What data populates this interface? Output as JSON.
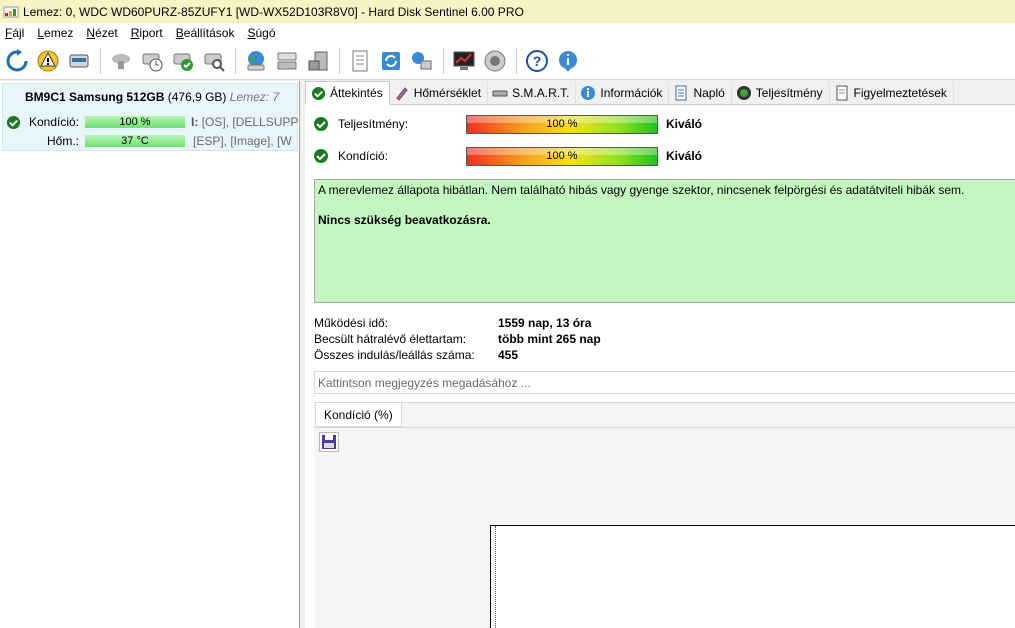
{
  "window": {
    "title": "Lemez: 0, WDC WD60PURZ-85ZUFY1 [WD-WX52D103R8V0]  -  Hard Disk Sentinel 6.00 PRO"
  },
  "menu": [
    {
      "label": "Fájl",
      "u": "F",
      "rest": "ájl"
    },
    {
      "label": "Lemez",
      "u": "L",
      "rest": "emez"
    },
    {
      "label": "Nézet",
      "u": "N",
      "rest": "ézet"
    },
    {
      "label": "Riport",
      "u": "R",
      "rest": "iport"
    },
    {
      "label": "Beállítások",
      "u": "B",
      "rest": "eállítások"
    },
    {
      "label": "Súgó",
      "u": "S",
      "rest": "úgó"
    }
  ],
  "toolbar": {
    "icons": [
      "refresh-icon",
      "alert-icon",
      "disk-icon",
      "disk-cloud-icon",
      "disk-clock-icon",
      "disk-check-icon",
      "disk-search-icon",
      "globe-disk-icon",
      "server-disk-icon",
      "hdd-stack-icon",
      "report-icon",
      "sync-icon",
      "network-icon",
      "monitor-chart-icon",
      "speaker-icon",
      "help-icon",
      "info-icon"
    ]
  },
  "disk": {
    "name": "BM9C1 Samsung 512GB",
    "size": "(476,9 GB)",
    "lemez": "Lemez: 7",
    "kondicio_label": "Kondíció:",
    "kondicio_value": "100 %",
    "hom_label": "Hőm.:",
    "hom_value": "37 °C",
    "parts_line1_letter": "I:",
    "parts_line1": "[OS],  [DELLSUPPORT",
    "parts_line2": "[ESP],  [Image],  [W"
  },
  "tabs": [
    {
      "label": "Áttekintés",
      "icon": "check-icon",
      "active": true
    },
    {
      "label": "Hőmérséklet",
      "icon": "thermometer-icon"
    },
    {
      "label": "S.M.A.R.T.",
      "icon": "smart-icon"
    },
    {
      "label": "Információk",
      "icon": "info-icon"
    },
    {
      "label": "Napló",
      "icon": "log-icon"
    },
    {
      "label": "Teljesítmény",
      "icon": "gauge-icon"
    },
    {
      "label": "Figyelmeztetések",
      "icon": "warning-doc-icon"
    }
  ],
  "overview": {
    "performance_label": "Teljesítmény:",
    "performance_value": "100 %",
    "performance_pct": 100,
    "performance_rating": "Kiváló",
    "condition_label": "Kondíció:",
    "condition_value": "100 %",
    "condition_pct": 100,
    "condition_rating": "Kiváló",
    "status_text": "A merevlemez állapota hibátlan. Nem található hibás vagy gyenge szektor, nincsenek felpörgési és adatátviteli hibák sem.",
    "status_action": "Nincs szükség beavatkozásra.",
    "uptime_label": "Működési idő:",
    "uptime_value": "1559 nap, 13 óra",
    "lifetime_label": "Becsült hátralévő élettartam:",
    "lifetime_value": "több mint 265 nap",
    "starts_label": "Összes indulás/leállás száma:",
    "starts_value": "455",
    "note_placeholder": "Kattintson megjegyzés megadásához ..."
  },
  "chart_panel": {
    "tab_label": "Kondíció  (%)"
  },
  "colors": {
    "title_bg": "#f7f3c4",
    "status_bg": "#c4f7bf",
    "selected_disk_bg": "#e8f6fb",
    "check_green": "#1e7a1e"
  }
}
